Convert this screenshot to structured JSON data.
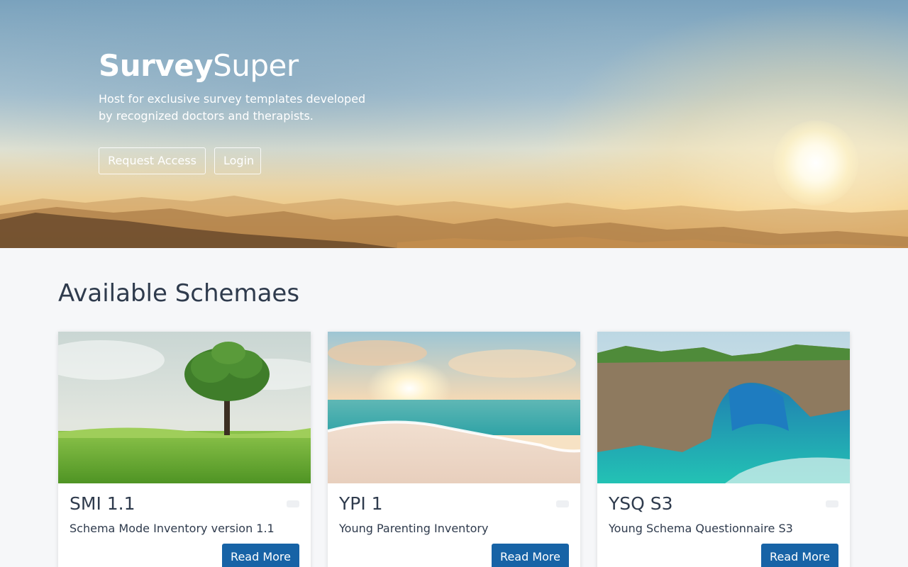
{
  "hero": {
    "brand_bold": "Survey",
    "brand_light": "Super",
    "tagline": "Host for exclusive survey templates developed by recognized doctors and therapists.",
    "request_access_label": "Request Access",
    "login_label": "Login"
  },
  "section": {
    "title": "Available Schemaes"
  },
  "cards": [
    {
      "title": "SMI 1.1",
      "description": "Schema Mode Inventory version 1.1",
      "button_label": "Read More",
      "image": "tree-in-field-image"
    },
    {
      "title": "YPI 1",
      "description": "Young Parenting Inventory",
      "button_label": "Read More",
      "image": "beach-sunset-image"
    },
    {
      "title": "YSQ S3",
      "description": "Young Schema Questionnaire S3",
      "button_label": "Read More",
      "image": "sea-arch-cliff-image"
    }
  ],
  "colors": {
    "primary_button": "#1763a6",
    "page_background": "#f6f7f9",
    "text": "#2f3b4d"
  }
}
